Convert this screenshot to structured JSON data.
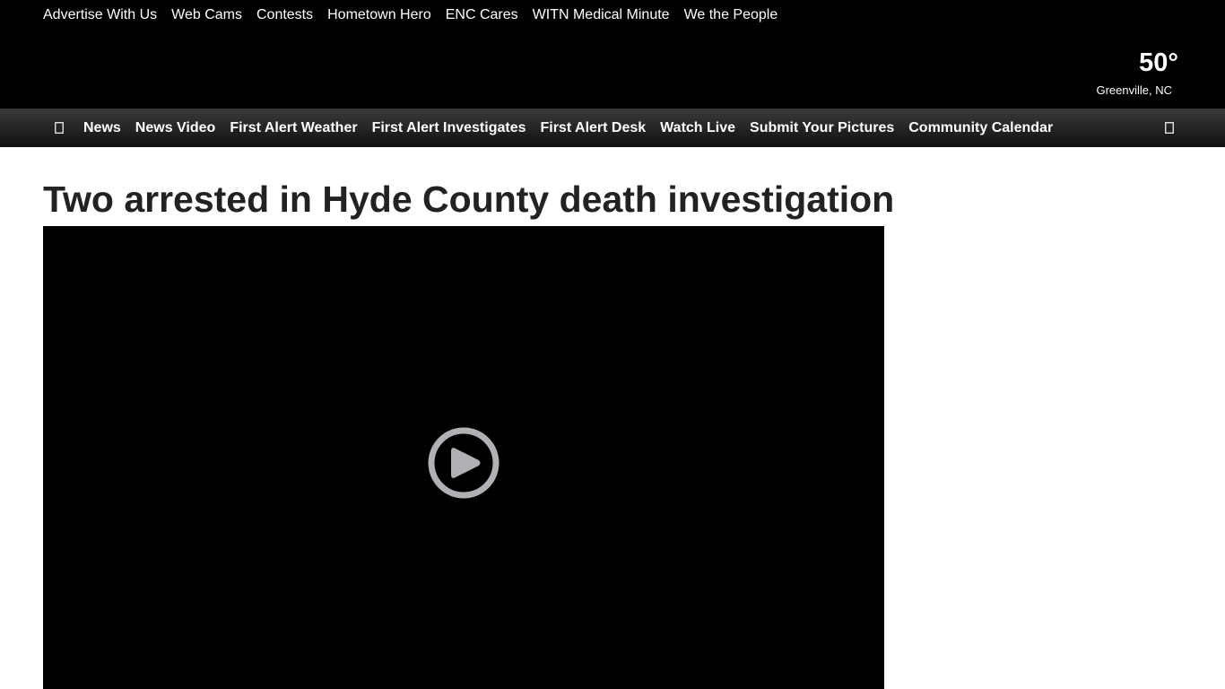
{
  "utility_nav": {
    "items": [
      "Advertise With Us",
      "Web Cams",
      "Contests",
      "Hometown Hero",
      "ENC Cares",
      "WITN Medical Minute",
      "We the People"
    ]
  },
  "weather": {
    "temperature": "50°",
    "location": "Greenville, NC"
  },
  "main_nav": {
    "menu_icon": "menu-icon",
    "search_icon": "search-icon",
    "items": [
      "News",
      "News Video",
      "First Alert Weather",
      "First Alert Investigates",
      "First Alert Desk",
      "Watch Live",
      "Submit Your Pictures",
      "Community Calendar"
    ]
  },
  "article": {
    "headline": "Two arrested in Hyde County death investigation"
  },
  "video": {
    "play_icon": "play-icon"
  },
  "colors": {
    "header_bg": "#000000",
    "nav_bg_top": "#3a3a3a",
    "nav_bg_bottom": "#101010",
    "headline_text": "#222222",
    "play_button": "#b0b0b5"
  }
}
